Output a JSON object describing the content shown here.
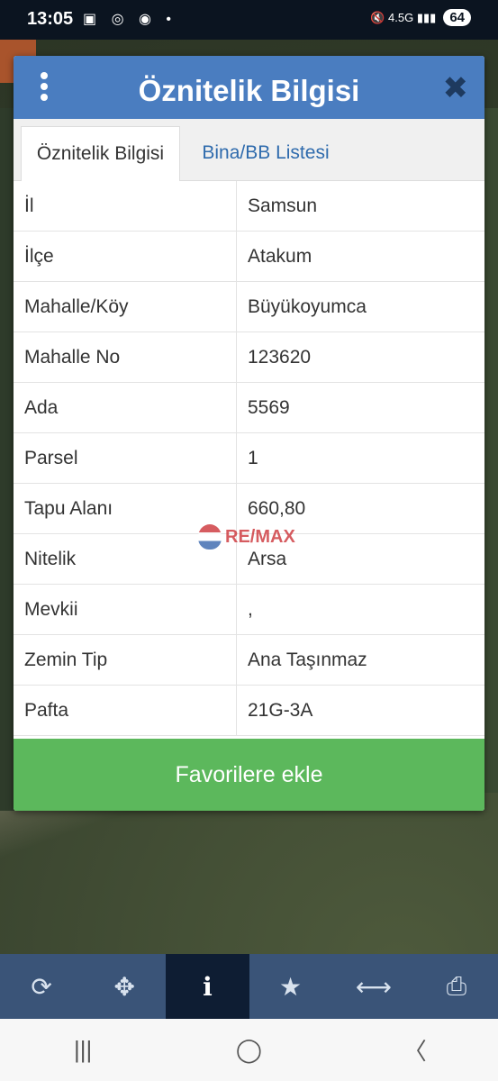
{
  "status_bar": {
    "time": "13:05",
    "left_icons": "▣ ◎ ◉ •",
    "right_icons": "🔇 4.5G ▮▮▮",
    "battery": "64"
  },
  "dialog": {
    "title": "Öznitelik Bilgisi",
    "tabs": [
      {
        "label": "Öznitelik Bilgisi",
        "active": true
      },
      {
        "label": "Bina/BB Listesi",
        "active": false
      }
    ],
    "rows": [
      {
        "key": "İl",
        "value": "Samsun"
      },
      {
        "key": "İlçe",
        "value": "Atakum"
      },
      {
        "key": "Mahalle/Köy",
        "value": "Büyükoyumca"
      },
      {
        "key": "Mahalle No",
        "value": "123620"
      },
      {
        "key": "Ada",
        "value": "5569"
      },
      {
        "key": "Parsel",
        "value": "1"
      },
      {
        "key": "Tapu Alanı",
        "value": "660,80"
      },
      {
        "key": "Nitelik",
        "value": "Arsa"
      },
      {
        "key": "Mevkii",
        "value": ","
      },
      {
        "key": "Zemin Tip",
        "value": "Ana Taşınmaz"
      },
      {
        "key": "Pafta",
        "value": "21G-3A"
      }
    ],
    "favorite_button": "Favorilere ekle",
    "watermark": "RE/MAX"
  },
  "toolbar": {
    "items": [
      {
        "name": "refresh-icon",
        "glyph": "⟳"
      },
      {
        "name": "locate-icon",
        "glyph": "✥"
      },
      {
        "name": "info-icon",
        "glyph": "i"
      },
      {
        "name": "star-icon",
        "glyph": "★"
      },
      {
        "name": "measure-icon",
        "glyph": "⟷"
      },
      {
        "name": "print-icon",
        "glyph": "⎙"
      }
    ]
  },
  "nav": {
    "recents": "|||",
    "home": "◯",
    "back": "〈"
  },
  "colors": {
    "header": "#4a7dc0",
    "favorite": "#5cb85c",
    "toolbar": "#3a5478",
    "toolbar_active": "#0e1d33"
  }
}
